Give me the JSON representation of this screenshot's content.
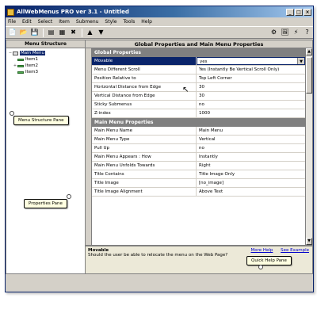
{
  "window": {
    "title": "AllWebMenus PRO ver 3.1 - Untitled"
  },
  "menubar": [
    "File",
    "Edit",
    "Select",
    "Item",
    "Submenu",
    "Style",
    "Tools",
    "Help"
  ],
  "left_pane": {
    "header": "Menu Structure",
    "tree": [
      {
        "label": "Main Menu",
        "indent": 0,
        "selected": true,
        "expander": "−"
      },
      {
        "label": "Item1",
        "indent": 1,
        "selected": false,
        "expander": ""
      },
      {
        "label": "Item2",
        "indent": 1,
        "selected": false,
        "expander": "+"
      },
      {
        "label": "Item3",
        "indent": 1,
        "selected": false,
        "expander": ""
      }
    ]
  },
  "right_pane": {
    "header": "Global Properties and Main Menu Properties",
    "sections": [
      {
        "title": "Global Properties",
        "rows": [
          {
            "key": "Movable",
            "value": "yes",
            "selected": true,
            "dropdown": true
          },
          {
            "key": "Menu Different Scroll",
            "value": "Yes (Instantly Be Vertical Scroll Only)"
          },
          {
            "key": "Position Relative to",
            "value": "Top Left Corner"
          },
          {
            "key": "Horizontal Distance from Edge",
            "value": "30"
          },
          {
            "key": "Vertical Distance from Edge",
            "value": "30"
          },
          {
            "key": "Sticky Submenus",
            "value": "no"
          },
          {
            "key": "Z-index",
            "value": "1000"
          }
        ]
      },
      {
        "title": "Main Menu Properties",
        "rows": [
          {
            "key": "Main Menu Name",
            "value": "Main Menu"
          },
          {
            "key": "Main Menu Type",
            "value": "Vertical"
          },
          {
            "key": "Pull Up",
            "value": "no"
          },
          {
            "key": "Main Menu Appears : How",
            "value": "Instantly"
          },
          {
            "key": "Main Menu Unfolds Towards",
            "value": "Right"
          },
          {
            "key": "Title Contains",
            "value": "Title Image Only"
          },
          {
            "key": "Title Image",
            "value": "[no_image]"
          },
          {
            "key": "Title Image Alignment",
            "value": "Above Text"
          }
        ]
      }
    ]
  },
  "help": {
    "title": "Movable",
    "text": "Should the user be able to relocate the menu on the Web Page?",
    "link_more": "More Help",
    "link_example": "See Example"
  },
  "callouts": {
    "menu_structure": "Menu Structure Pane",
    "properties": "Properties Pane",
    "quick_help": "Quick Help Pane"
  },
  "colors": {
    "title_bar": "#0a246a",
    "selection": "#0a246a",
    "section_header": "#808080",
    "tooltip": "#ffffe1"
  }
}
